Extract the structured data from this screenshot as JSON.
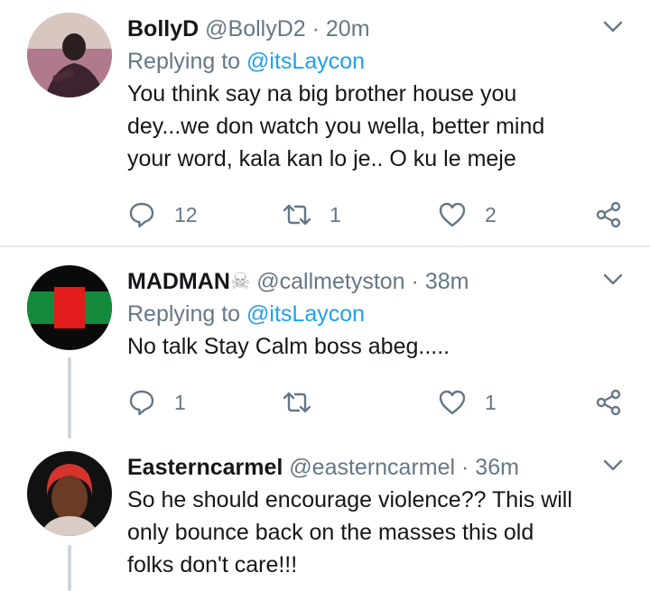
{
  "tweets": [
    {
      "name": "BollyD",
      "handle": "@BollyD2",
      "time": "20m",
      "replying_label": "Replying to",
      "replying_to": "@itsLaycon",
      "lines": [
        "You think say na big brother house you",
        "dey...we don watch you wella, better mind",
        "your word, kala kan lo je.. O ku le meje"
      ],
      "replies": "12",
      "retweets": "1",
      "likes": "2"
    },
    {
      "name": "MADMAN",
      "name_emoji": "☠",
      "handle": "@callmetyston",
      "time": "38m",
      "replying_label": "Replying to",
      "replying_to": "@itsLaycon",
      "lines": [
        "No talk Stay Calm boss abeg....."
      ],
      "replies": "1",
      "retweets": "",
      "likes": "1"
    },
    {
      "name": "Easterncarmel",
      "handle": "@easterncarmel",
      "time": "36m",
      "lines": [
        "So he should encourage violence?? This will",
        "only bounce back on the masses this old",
        "folks don't care!!!"
      ]
    }
  ],
  "separator": "·",
  "icons": {
    "reply": "reply-icon",
    "retweet": "retweet-icon",
    "like": "heart-icon",
    "share": "share-icon",
    "caret": "chevron-down-icon"
  },
  "colors": {
    "link": "#1da1f2",
    "secondary_text": "#657786",
    "divider": "#e6ecf0",
    "thread_line": "#ccd6dd"
  }
}
